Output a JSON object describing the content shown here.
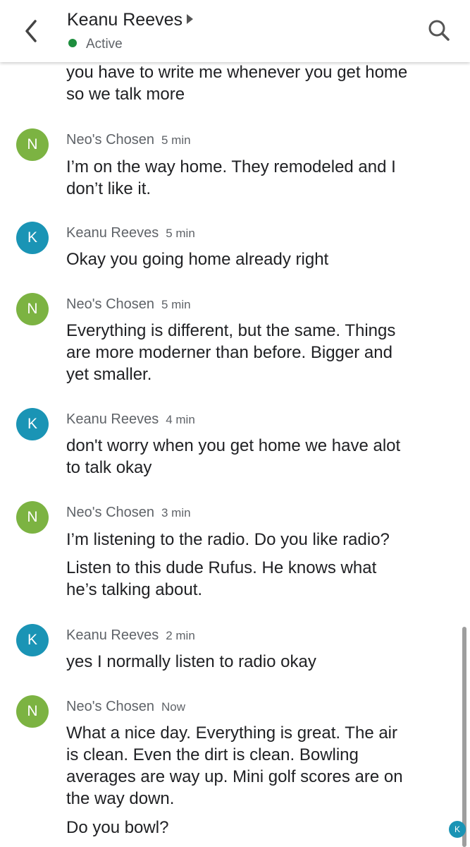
{
  "header": {
    "contact_name": "Keanu Reeves",
    "status": "Active",
    "status_color": "#1e8e3e",
    "back_icon": "chevron-left-icon",
    "search_icon": "search-icon"
  },
  "colors": {
    "avatar_n": "#7cb342",
    "avatar_k": "#1a94b5"
  },
  "conversation": {
    "partial_message": {
      "lines": [
        "you have to write me whenever you get home",
        "so we talk more"
      ]
    },
    "messages": [
      {
        "avatar": "N",
        "sender": "Neo's Chosen",
        "time": "5 min",
        "lines": [
          "I’m on the way home. They remodeled and I",
          "don’t like it."
        ]
      },
      {
        "avatar": "K",
        "sender": "Keanu Reeves",
        "time": "5 min",
        "lines": [
          "Okay you going home already right"
        ]
      },
      {
        "avatar": "N",
        "sender": "Neo's Chosen",
        "time": "5 min",
        "lines": [
          "Everything is different, but the same. Things",
          "are more moderner than before. Bigger and",
          "yet smaller."
        ]
      },
      {
        "avatar": "K",
        "sender": "Keanu Reeves",
        "time": "4 min",
        "lines": [
          "don't worry when you get home we have alot",
          "to talk okay"
        ]
      },
      {
        "avatar": "N",
        "sender": "Neo's Chosen",
        "time": "3 min",
        "lines": [
          "I’m listening to the radio. Do you like radio?"
        ],
        "lines2": [
          "Listen to this dude Rufus. He knows what",
          "he’s talking about."
        ]
      },
      {
        "avatar": "K",
        "sender": "Keanu Reeves",
        "time": "2 min",
        "lines": [
          "yes I normally listen to radio okay"
        ]
      },
      {
        "avatar": "N",
        "sender": "Neo's Chosen",
        "time": "Now",
        "lines": [
          "What a nice day. Everything is great. The air",
          "is clean. Even the dirt is clean. Bowling",
          "averages are way up. Mini golf scores are on",
          "the way down."
        ],
        "lines2": [
          "Do you bowl?"
        ]
      }
    ]
  },
  "seen_indicator": "K"
}
